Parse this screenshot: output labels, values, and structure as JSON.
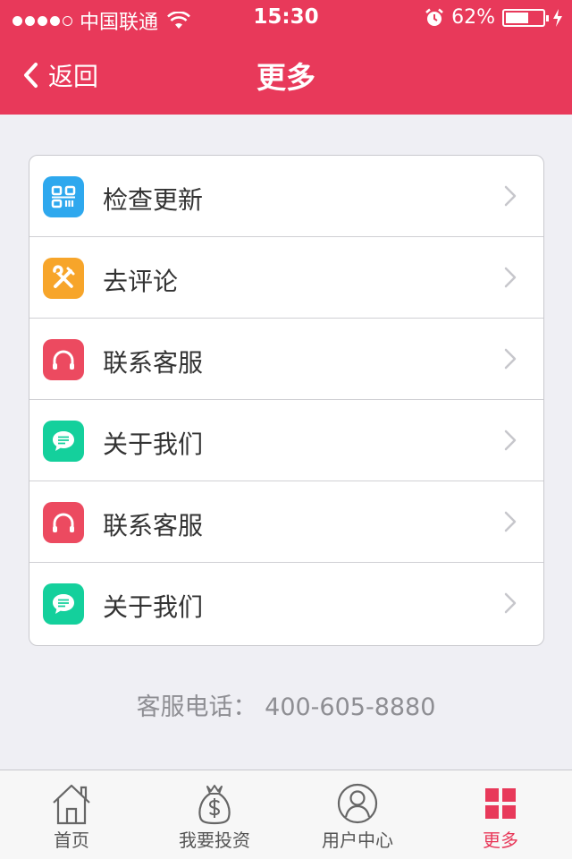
{
  "status_bar": {
    "carrier": "中国联通",
    "time": "15:30",
    "battery_text": "62%",
    "battery_level": 0.62
  },
  "nav": {
    "back_label": "返回",
    "title": "更多"
  },
  "menu": {
    "items": [
      {
        "label": "检查更新",
        "icon": "qr-scan-icon",
        "color": "#2ea8ee"
      },
      {
        "label": "去评论",
        "icon": "tools-icon",
        "color": "#f7a52a"
      },
      {
        "label": "联系客服",
        "icon": "headphones-icon",
        "color": "#ec4a60"
      },
      {
        "label": "关于我们",
        "icon": "chat-bubble-icon",
        "color": "#14d09c"
      },
      {
        "label": "联系客服",
        "icon": "headphones-icon",
        "color": "#ec4a60"
      },
      {
        "label": "关于我们",
        "icon": "chat-bubble-icon",
        "color": "#14d09c"
      }
    ]
  },
  "service_phone": "客服电话： 400-605-8880",
  "tabs": [
    {
      "label": "首页",
      "icon": "home-icon",
      "active": false
    },
    {
      "label": "我要投资",
      "icon": "money-bag-icon",
      "active": false
    },
    {
      "label": "用户中心",
      "icon": "user-icon",
      "active": false
    },
    {
      "label": "更多",
      "icon": "grid-icon",
      "active": true
    }
  ],
  "colors": {
    "brand": "#e8395a",
    "background": "#efeff4"
  }
}
